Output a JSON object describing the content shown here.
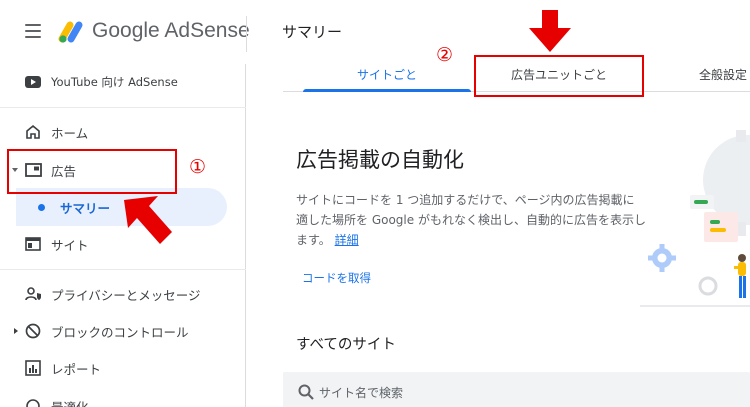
{
  "app": {
    "brand_google": "Google",
    "brand_product": "AdSense",
    "page_title": "サマリー"
  },
  "sidebar": {
    "youtube": "YouTube 向け AdSense",
    "home": "ホーム",
    "ads": "広告",
    "summary": "サマリー",
    "sites": "サイト",
    "privacy": "プライバシーとメッセージ",
    "blocking": "ブロックのコントロール",
    "reports": "レポート",
    "cut_off": "最適化"
  },
  "tabs": [
    {
      "label": "サイトごと",
      "active": true
    },
    {
      "label": "広告ユニットごと",
      "active": false
    },
    {
      "label": "全般設定",
      "active": false
    }
  ],
  "content": {
    "heading": "広告掲載の自動化",
    "description": "サイトにコードを 1 つ追加するだけで、ページ内の広告掲載に適した場所を Google がもれなく検出し、自動的に広告を表示します。",
    "details_link": "詳細",
    "get_code": "コードを取得",
    "all_sites": "すべてのサイト",
    "search_placeholder": "サイト名で検索"
  },
  "annotations": {
    "marker_1": "①",
    "marker_2": "②"
  },
  "colors": {
    "accent": "#1a73e8",
    "annotation_red": "#e60000"
  }
}
